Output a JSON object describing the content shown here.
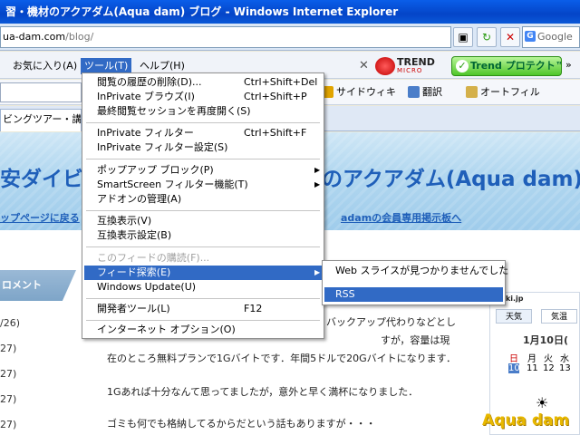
{
  "window": {
    "title": "習・機材のアクアダム(Aqua dam) ブログ - Windows Internet Explorer"
  },
  "address": {
    "host": "ua-dam.com",
    "path": "/blog/"
  },
  "search": {
    "placeholder": "Google"
  },
  "menubar": {
    "items": [
      "お気に入り(A)",
      "ツール(T)",
      "ヘルプ(H)"
    ],
    "active_index": 1,
    "trend_logo_main": "TREND",
    "trend_logo_sub": "MICRO",
    "trend_button": "Trend プロテクト™"
  },
  "linkbar": {
    "items": [
      "サイドウィキ",
      "翻訳",
      "オートフィル"
    ]
  },
  "tab": {
    "label": "ビングツアー・講習・機"
  },
  "page": {
    "site_title": "安ダイビ",
    "site_title_right": "のアクアダム(Aqua dam) ブ",
    "nav_left": "ップページに戻る",
    "nav_right": "adamの会員専用掲示板へ",
    "side_heading": "ロメント",
    "dates": [
      "/26)",
      "27)",
      "27)",
      "27)",
      "27)"
    ],
    "body_lines": [
      "バックアップ代わりなどとし",
      "すが，容量は現",
      "在のところ無料プランで1Gバイトです．年間5ドルで20Gバイトになります．",
      "1Gあれば十分なんて思ってましたが，意外と早く満杯になりました．",
      "ゴミも何でも格納してるからだという話もありますが・・・"
    ],
    "widget_brand": "tenki.jp",
    "widget_tabs": [
      "天気",
      "気温"
    ],
    "widget_date": "1月10日(",
    "widget_days": [
      "日",
      "月",
      "火",
      "水"
    ],
    "widget_nums": [
      "10",
      "11",
      "12",
      "13"
    ],
    "logo": "Aqua dam"
  },
  "tools_menu": {
    "items": [
      {
        "label": "閲覧の履歴の削除(D)...",
        "shortcut": "Ctrl+Shift+Del"
      },
      {
        "label": "InPrivate ブラウズ(I)",
        "shortcut": "Ctrl+Shift+P"
      },
      {
        "label": "最終閲覧セッションを再度開く(S)",
        "shortcut": ""
      },
      {
        "label": "InPrivate フィルター",
        "shortcut": "Ctrl+Shift+F"
      },
      {
        "label": "InPrivate フィルター設定(S)",
        "shortcut": ""
      },
      {
        "label": "ポップアップ ブロック(P)",
        "shortcut": ""
      },
      {
        "label": "SmartScreen フィルター機能(T)",
        "shortcut": ""
      },
      {
        "label": "アドオンの管理(A)",
        "shortcut": ""
      },
      {
        "label": "互換表示(V)",
        "shortcut": ""
      },
      {
        "label": "互換表示設定(B)",
        "shortcut": ""
      },
      {
        "label": "このフィードの購読(F)...",
        "shortcut": ""
      },
      {
        "label": "フィード探索(E)",
        "shortcut": ""
      },
      {
        "label": "Windows Update(U)",
        "shortcut": ""
      },
      {
        "label": "開発者ツール(L)",
        "shortcut": "F12"
      },
      {
        "label": "インターネット オプション(O)",
        "shortcut": ""
      }
    ]
  },
  "feed_submenu": {
    "items": [
      "Web スライスが見つかりませんでした",
      "RSS"
    ]
  }
}
